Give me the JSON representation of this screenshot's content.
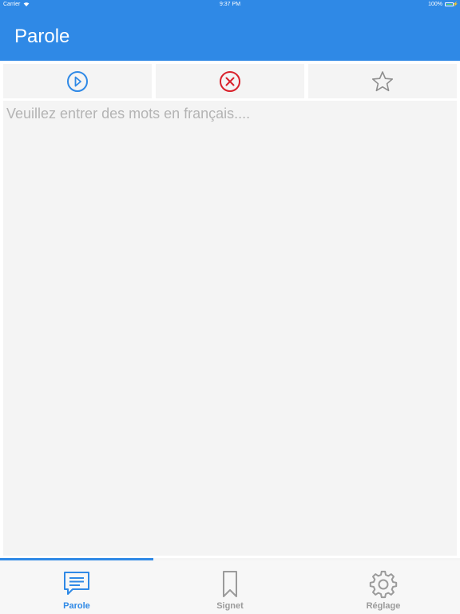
{
  "status_bar": {
    "carrier": "Carrier",
    "time": "9:37 PM",
    "battery": "100%"
  },
  "nav": {
    "title": "Parole"
  },
  "toolbar": {
    "buttons": [
      {
        "icon": "play-circle-icon",
        "color": "#2f89e6"
      },
      {
        "icon": "clear-circle-icon",
        "color": "#d9212b"
      },
      {
        "icon": "star-icon",
        "color": "#8e8e8e"
      }
    ]
  },
  "input": {
    "placeholder": "Veuillez entrer des mots en français....",
    "value": ""
  },
  "progress": {
    "value": 0.333
  },
  "tabs": {
    "active_color": "#2f89e6",
    "inactive_color": "#9b9b9b",
    "items": [
      {
        "label": "Parole",
        "icon": "chat-bubble-icon",
        "active": true
      },
      {
        "label": "Signet",
        "icon": "bookmark-icon",
        "active": false
      },
      {
        "label": "Réglage",
        "icon": "gear-icon",
        "active": false
      }
    ]
  }
}
